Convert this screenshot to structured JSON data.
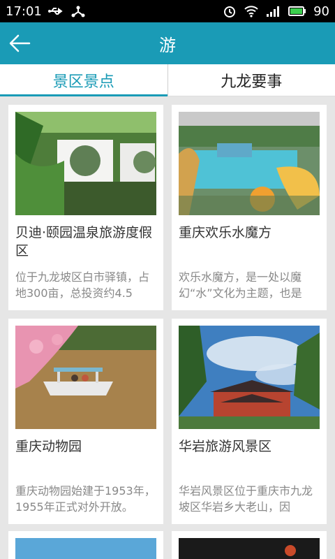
{
  "status": {
    "time": "17:01",
    "battery": "90"
  },
  "appbar": {
    "title": "游"
  },
  "tabs": [
    {
      "label": "景区景点"
    },
    {
      "label": "九龙要事"
    }
  ],
  "cards": [
    {
      "name": "贝迪·颐园温泉旅游度假区",
      "desc": "位于九龙坡区白市驿镇，占地300亩，总投资约4.5"
    },
    {
      "name": "重庆欢乐水魔方",
      "desc": "欢乐水魔方，是一处以魔幻“水”文化为主题，也是"
    },
    {
      "name": "重庆动物园",
      "desc": "重庆动物园始建于1953年，1955年正式对外开放。"
    },
    {
      "name": "华岩旅游风景区",
      "desc": "华岩风景区位于重庆市九龙坡区华岩乡大老山，因"
    }
  ],
  "colors": {
    "accent": "#1a9bb6"
  }
}
